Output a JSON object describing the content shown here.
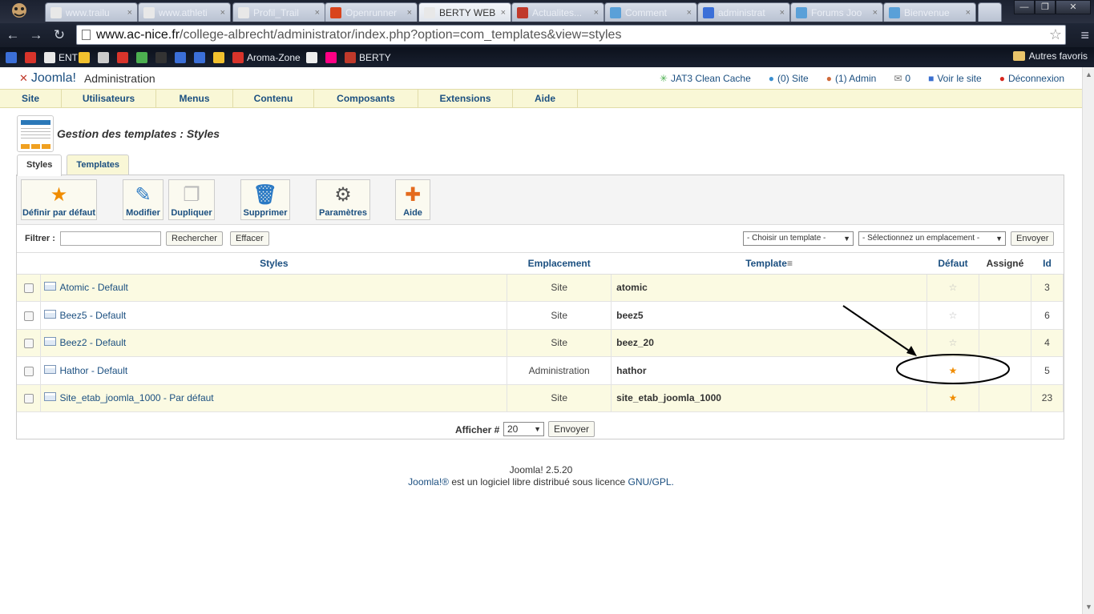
{
  "browser": {
    "tabs": [
      {
        "title": "www.trailu",
        "favicon_color": "#e8e8e8",
        "active": false
      },
      {
        "title": "www.athleti",
        "favicon_color": "#e8e8e8",
        "active": false
      },
      {
        "title": "Profil_Trail",
        "favicon_color": "#e8e8e8",
        "active": false
      },
      {
        "title": "Openrunner",
        "favicon_color": "#d9441c",
        "active": false
      },
      {
        "title": "BERTY WEB",
        "favicon_color": "#e8e8e8",
        "active": true
      },
      {
        "title": "Actualites...",
        "favicon_color": "#c0392b",
        "active": false
      },
      {
        "title": "Comment",
        "favicon_color": "#5aa0d8",
        "active": false
      },
      {
        "title": "administrat",
        "favicon_color": "#3b6fd8",
        "active": false
      },
      {
        "title": "Forums Joo",
        "favicon_color": "#5aa0d8",
        "active": false
      },
      {
        "title": "Bienvenue",
        "favicon_color": "#5aa0d8",
        "active": false
      }
    ],
    "tab_close_glyph": "×",
    "window_controls": {
      "minimize": "—",
      "restore": "❐",
      "close": "✕"
    },
    "nav": {
      "back": "←",
      "forward": "→",
      "reload": "↻"
    },
    "url_host": "www.ac-nice.fr",
    "url_path": "/college-albrecht/administrator/index.php?option=com_templates&view=styles",
    "bookmark_star": "☆",
    "menu_glyph": "≡",
    "bookmarks": [
      {
        "label": "",
        "icon_color": "#3b6fd8"
      },
      {
        "label": "",
        "icon_color": "#d8342b"
      },
      {
        "label": "ENT",
        "icon_color": "#e8e8e8"
      },
      {
        "label": "",
        "icon_color": "#f2c12e"
      },
      {
        "label": "",
        "icon_color": "#cccccc"
      },
      {
        "label": "",
        "icon_color": "#d8342b"
      },
      {
        "label": "",
        "icon_color": "#4caf50"
      },
      {
        "label": "",
        "icon_color": "#333333"
      },
      {
        "label": "",
        "icon_color": "#3b6fd8"
      },
      {
        "label": "",
        "icon_color": "#3b6fd8"
      },
      {
        "label": "",
        "icon_color": "#f2c12e"
      },
      {
        "label": "Aroma-Zone",
        "icon_color": "#d8342b"
      },
      {
        "label": "",
        "icon_color": "#eeeeee"
      },
      {
        "label": "",
        "icon_color": "#ff0084"
      },
      {
        "label": "BERTY",
        "icon_color": "#c0392b"
      }
    ],
    "other_bookmarks": "Autres favoris"
  },
  "joomla": {
    "brand": "Joomla!",
    "brand_mark": "✕",
    "admin_label": "Administration",
    "status": [
      {
        "icon": "✳",
        "label": "JAT3 Clean Cache",
        "color": "#4caf50"
      },
      {
        "icon": "●",
        "label": "(0) Site",
        "color": "#3a8fd0"
      },
      {
        "icon": "●",
        "label": "(1) Admin",
        "color": "#d06a3a"
      },
      {
        "icon": "✉",
        "label": "0",
        "color": "#777777"
      },
      {
        "icon": "■",
        "label": "Voir le site",
        "color": "#3a6fd0"
      },
      {
        "icon": "●",
        "label": "Déconnexion",
        "color": "#d8261d"
      }
    ],
    "menu": [
      "Site",
      "Utilisateurs",
      "Menus",
      "Contenu",
      "Composants",
      "Extensions",
      "Aide"
    ],
    "page_title": "Gestion des templates : Styles",
    "subtabs": [
      "Styles",
      "Templates"
    ],
    "toolbar": [
      {
        "label": "Définir par défaut",
        "icon": "★",
        "icon_color": "#f08c00"
      },
      {
        "label": "Modifier",
        "icon": "✎",
        "icon_color": "#2a79c4"
      },
      {
        "label": "Dupliquer",
        "icon": "❐",
        "icon_color": "#bbbbbb"
      },
      {
        "label": "Supprimer",
        "icon": "🗑",
        "icon_color": "#2a79c4"
      },
      {
        "label": "Paramètres",
        "icon": "⚙",
        "icon_color": "#555555"
      },
      {
        "label": "Aide",
        "icon": "✚",
        "icon_color": "#e46a1d"
      }
    ],
    "filter": {
      "label": "Filtrer :",
      "value": "",
      "search_button": "Rechercher",
      "clear_button": "Effacer",
      "template_select": "- Choisir un template -",
      "location_select": "- Sélectionnez un emplacement -",
      "submit_button": "Envoyer"
    },
    "table": {
      "headers": [
        "Styles",
        "Emplacement",
        "Template",
        "Défaut",
        "Assigné",
        "Id"
      ],
      "rows": [
        {
          "style": "Atomic - Default",
          "location": "Site",
          "template": "atomic",
          "default": false,
          "assigned": "",
          "id": "3"
        },
        {
          "style": "Beez5 - Default",
          "location": "Site",
          "template": "beez5",
          "default": false,
          "assigned": "",
          "id": "6"
        },
        {
          "style": "Beez2 - Default",
          "location": "Site",
          "template": "beez_20",
          "default": false,
          "assigned": "",
          "id": "4"
        },
        {
          "style": "Hathor - Default",
          "location": "Administration",
          "template": "hathor",
          "default": true,
          "assigned": "",
          "id": "5"
        },
        {
          "style": "Site_etab_joomla_1000 - Par défaut",
          "location": "Site",
          "template": "site_etab_joomla_1000",
          "default": true,
          "assigned": "",
          "id": "23"
        }
      ]
    },
    "pager": {
      "label": "Afficher #",
      "value": "20",
      "button": "Envoyer"
    },
    "footer": {
      "version": "Joomla! 2.5.20",
      "license_pre": "est un logiciel libre distribué sous licence",
      "brand_link": "Joomla!®",
      "license_link": "GNU/GPL."
    }
  }
}
